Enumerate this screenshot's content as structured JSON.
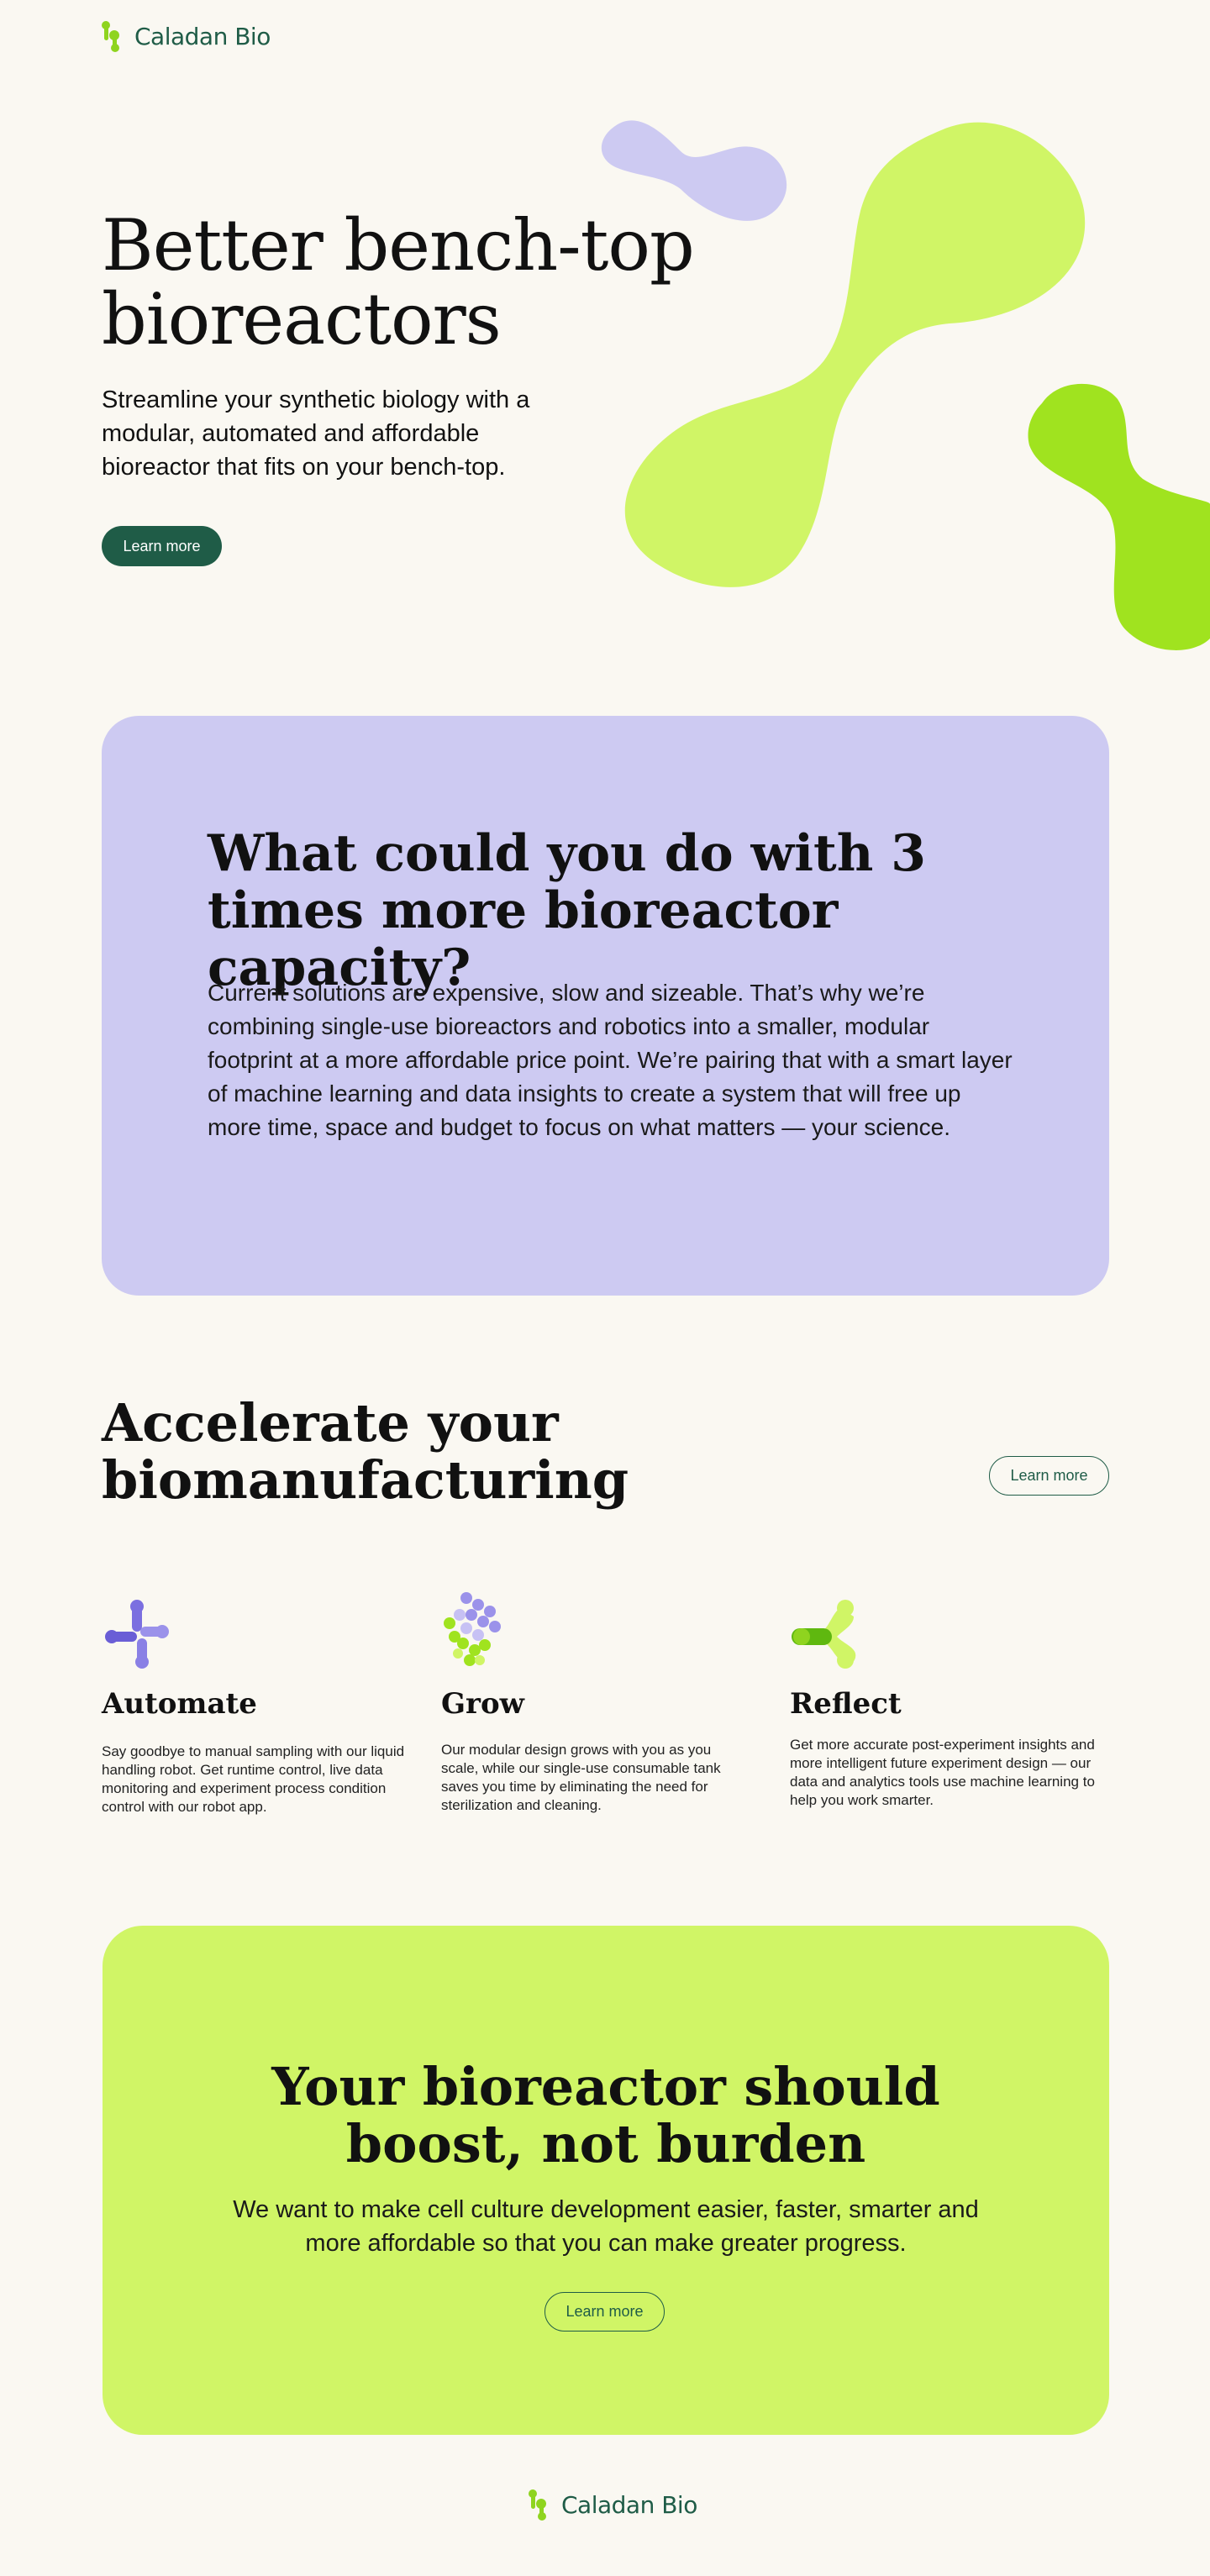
{
  "header": {
    "brand": "Caladan Bio"
  },
  "hero": {
    "title_line1": "Better bench-top",
    "title_line2": "bioreactors",
    "subtitle": "Streamline your synthetic biology with a modular, automated and affordable bioreactor that fits on your bench-top.",
    "cta": "Learn more"
  },
  "capacity": {
    "title": "What could you do with 3 times more bioreactor capacity?",
    "body": "Current solutions are expensive, slow and sizeable. That’s why we’re combining single-use bioreactors and robotics into a smaller, modular footprint at a more affordable price point. We’re pairing that with a smart layer of machine learning and data insights to create a system that will free up more time, space and budget to focus on what matters — your science."
  },
  "accelerate": {
    "title_line1": "Accelerate your",
    "title_line2": "biomanufacturing",
    "cta": "Learn more"
  },
  "features": [
    {
      "icon": "automate-icon",
      "title": "Automate",
      "body": "Say goodbye to manual sampling with our liquid handling robot. Get runtime control, live data monitoring and experiment process condition control with our robot app."
    },
    {
      "icon": "grow-icon",
      "title": "Grow",
      "body": "Our modular design grows with you as you scale, while our single-use consumable tank saves you time by eliminating the need for sterilization and cleaning."
    },
    {
      "icon": "reflect-icon",
      "title": "Reflect",
      "body": "Get more accurate post-experiment insights and more intelligent future experiment design — our data and analytics tools use machine learning to help you work smarter."
    }
  ],
  "boost": {
    "title_line1": "Your bioreactor should",
    "title_line2": "boost, not burden",
    "body": "We want to make cell culture development easier, faster, smarter and more affordable so that you can make greater progress.",
    "cta": "Learn more"
  },
  "footer": {
    "brand": "Caladan Bio"
  },
  "colors": {
    "background": "#faf8f2",
    "brand_green": "#1f5c47",
    "lime": "#d0f566",
    "lime_dark": "#a0e31f",
    "lavender": "#cdcaf2",
    "purple": "#7b6fe0"
  }
}
